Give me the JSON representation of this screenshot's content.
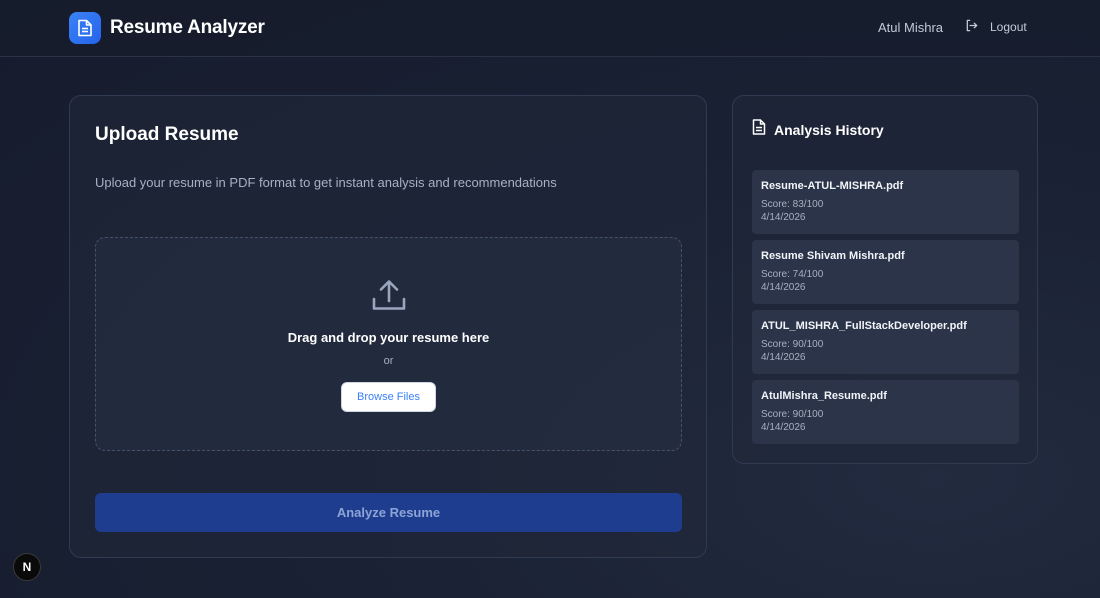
{
  "app": {
    "title": "Resume Analyzer",
    "accent": "#3b82f6"
  },
  "header": {
    "user_name": "Atul Mishra",
    "logout_label": "Logout"
  },
  "upload": {
    "title": "Upload Resume",
    "subtitle": "Upload your resume in PDF format to get instant analysis and recommendations",
    "drop_text": "Drag and drop your resume here",
    "or_text": "or",
    "browse_label": "Browse Files",
    "analyze_label": "Analyze Resume"
  },
  "history": {
    "title": "Analysis History",
    "items": [
      {
        "file": "Resume-ATUL-MISHRA.pdf",
        "score": "Score: 83/100",
        "date": "4/14/2026"
      },
      {
        "file": "Resume Shivam Mishra.pdf",
        "score": "Score: 74/100",
        "date": "4/14/2026"
      },
      {
        "file": "ATUL_MISHRA_FullStackDeveloper.pdf",
        "score": "Score: 90/100",
        "date": "4/14/2026"
      },
      {
        "file": "AtulMishra_Resume.pdf",
        "score": "Score: 90/100",
        "date": "4/14/2026"
      }
    ]
  },
  "badge": {
    "letter": "N"
  },
  "icons": [
    "document-icon",
    "logout-icon",
    "upload-icon",
    "file-icon"
  ]
}
